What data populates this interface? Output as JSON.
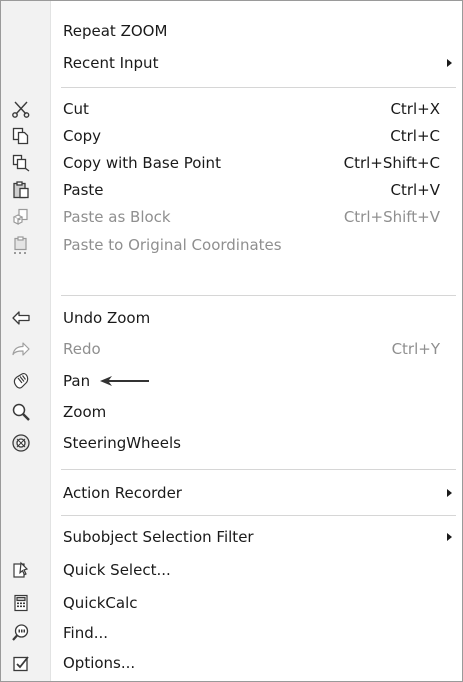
{
  "menu": {
    "items": [
      {
        "label": "Repeat ZOOM",
        "shortcut": "",
        "icon": "",
        "disabled": false,
        "submenu": false
      },
      {
        "label": "Recent Input",
        "shortcut": "",
        "icon": "",
        "disabled": false,
        "submenu": true
      },
      {
        "label": "Cut",
        "shortcut": "Ctrl+X",
        "icon": "scissors-icon",
        "disabled": false,
        "submenu": false
      },
      {
        "label": "Copy",
        "shortcut": "Ctrl+C",
        "icon": "copy-icon",
        "disabled": false,
        "submenu": false
      },
      {
        "label": "Copy with Base Point",
        "shortcut": "Ctrl+Shift+C",
        "icon": "copy-base-point-icon",
        "disabled": false,
        "submenu": false
      },
      {
        "label": "Paste",
        "shortcut": "Ctrl+V",
        "icon": "paste-icon",
        "disabled": false,
        "submenu": false
      },
      {
        "label": "Paste as Block",
        "shortcut": "Ctrl+Shift+V",
        "icon": "paste-block-icon",
        "disabled": true,
        "submenu": false
      },
      {
        "label": "Paste to Original Coordinates",
        "shortcut": "",
        "icon": "paste-coordinates-icon",
        "disabled": true,
        "submenu": false
      },
      {
        "label": "Undo Zoom",
        "shortcut": "",
        "icon": "undo-icon",
        "disabled": false,
        "submenu": false
      },
      {
        "label": "Redo",
        "shortcut": "Ctrl+Y",
        "icon": "redo-icon",
        "disabled": true,
        "submenu": false
      },
      {
        "label": "Pan",
        "shortcut": "",
        "icon": "pan-hand-icon",
        "disabled": false,
        "submenu": false
      },
      {
        "label": "Zoom",
        "shortcut": "",
        "icon": "magnifier-icon",
        "disabled": false,
        "submenu": false
      },
      {
        "label": "SteeringWheels",
        "shortcut": "",
        "icon": "steering-wheel-icon",
        "disabled": false,
        "submenu": false
      },
      {
        "label": "Action Recorder",
        "shortcut": "",
        "icon": "",
        "disabled": false,
        "submenu": true
      },
      {
        "label": "Subobject Selection Filter",
        "shortcut": "",
        "icon": "",
        "disabled": false,
        "submenu": true
      },
      {
        "label": "Quick Select...",
        "shortcut": "",
        "icon": "quick-select-icon",
        "disabled": false,
        "submenu": false
      },
      {
        "label": "QuickCalc",
        "shortcut": "",
        "icon": "calculator-icon",
        "disabled": false,
        "submenu": false
      },
      {
        "label": "Find...",
        "shortcut": "",
        "icon": "find-text-icon",
        "disabled": false,
        "submenu": false
      },
      {
        "label": "Options...",
        "shortcut": "",
        "icon": "options-checkbox-icon",
        "disabled": false,
        "submenu": false
      }
    ]
  },
  "colors": {
    "text": "#1a1a1a",
    "disabled_text": "#8f8f8f",
    "gutter": "#f2f2f2",
    "annotation_arrow": "#333333"
  }
}
